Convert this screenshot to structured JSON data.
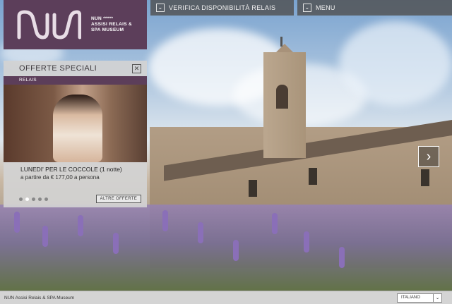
{
  "brand": {
    "short": "NUN *****",
    "full": "ASSISI RELAIS & SPA MUSEUM"
  },
  "topbar": {
    "availability_label": "VERIFICA DISPONIBILITÀ RELAIS",
    "menu_label": "MENU"
  },
  "offers": {
    "title": "OFFERTE SPECIALI",
    "category": "RELAIS",
    "name": "LUNEDI' PER LE COCCOLE (1 notte)",
    "price": "a partire da € 177,00 a persona",
    "more_label": "ALTRE OFFERTE",
    "slides_total": 5,
    "slide_active": 2
  },
  "footer": {
    "text": "NUN Assisi Relais & SPA Museum",
    "language": "ITALIANO"
  },
  "colors": {
    "brand_purple": "#5c3e5a",
    "topbar_gray": "#505050"
  }
}
